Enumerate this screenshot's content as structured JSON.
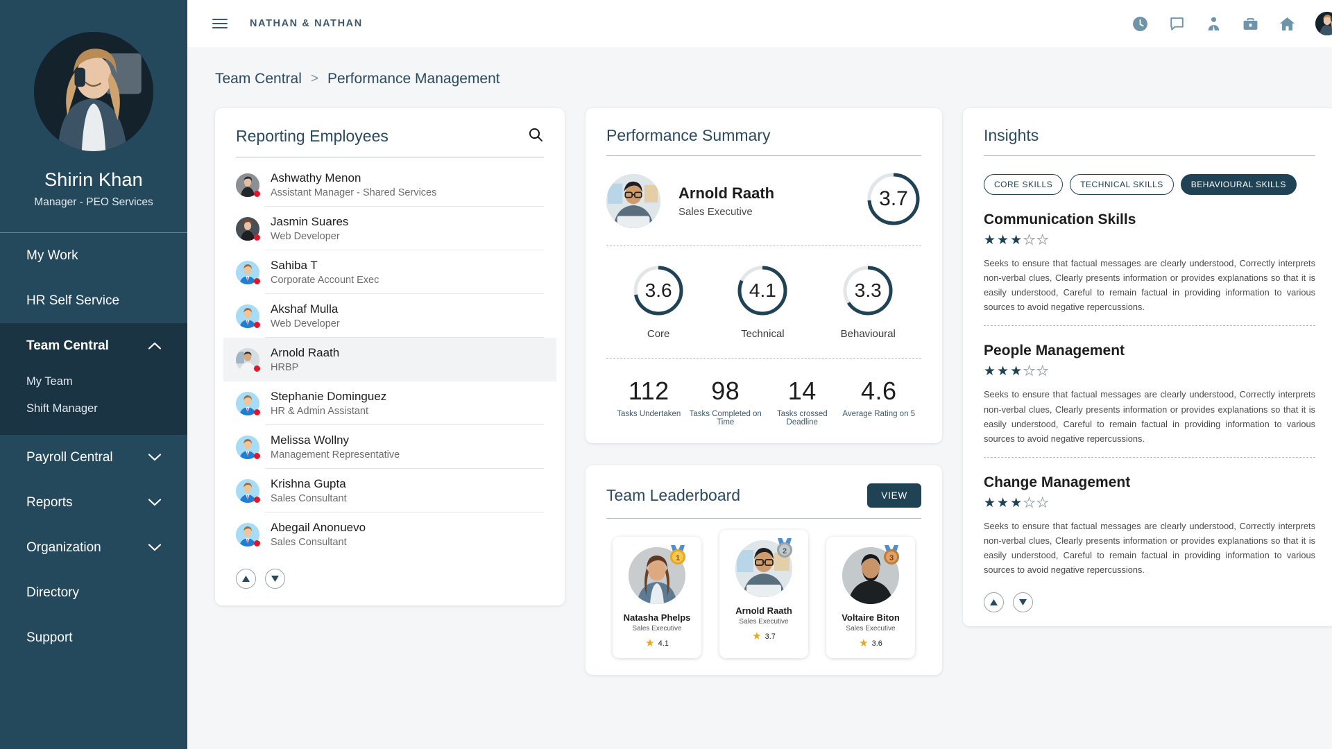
{
  "sidebar": {
    "profile": {
      "name": "Shirin Khan",
      "role": "Manager - PEO Services"
    },
    "items": [
      {
        "label": "My Work",
        "type": "link"
      },
      {
        "label": "HR Self Service",
        "type": "link"
      },
      {
        "label": "Team Central",
        "type": "group",
        "expanded": true,
        "children": [
          {
            "label": "My Team"
          },
          {
            "label": "Shift Manager"
          }
        ]
      },
      {
        "label": "Payroll Central",
        "type": "group",
        "expanded": false
      },
      {
        "label": "Reports",
        "type": "group",
        "expanded": false
      },
      {
        "label": "Organization",
        "type": "group",
        "expanded": false
      },
      {
        "label": "Directory",
        "type": "link"
      },
      {
        "label": "Support",
        "type": "link"
      }
    ]
  },
  "topbar": {
    "brand": "NATHAN & NATHAN",
    "menu_icon": "hamburger-icon",
    "icons": [
      "clock-icon",
      "chat-icon",
      "employee-icon",
      "briefcase-icon",
      "home-icon"
    ],
    "avatar": "user-avatar"
  },
  "breadcrumb": {
    "parent": "Team Central",
    "separator": ">",
    "current": "Performance Management"
  },
  "reporting_employees": {
    "title": "Reporting Employees",
    "search_icon": "search-icon",
    "items": [
      {
        "name": "Ashwathy Menon",
        "role": "Assistant Manager - Shared Services",
        "selected": false,
        "avatar": "photo-f1"
      },
      {
        "name": "Jasmin Suares",
        "role": "Web Developer",
        "selected": false,
        "avatar": "photo-f2"
      },
      {
        "name": "Sahiba T",
        "role": "Corporate Account Exec",
        "selected": false,
        "avatar": "cartoon"
      },
      {
        "name": "Akshaf Mulla",
        "role": "Web Developer",
        "selected": false,
        "avatar": "cartoon"
      },
      {
        "name": "Arnold Raath",
        "role": "HRBP",
        "selected": true,
        "avatar": "photo-m1"
      },
      {
        "name": "Stephanie Dominguez",
        "role": "HR & Admin Assistant",
        "selected": false,
        "avatar": "cartoon"
      },
      {
        "name": "Melissa Wollny",
        "role": "Management Representative",
        "selected": false,
        "avatar": "cartoon"
      },
      {
        "name": "Krishna Gupta",
        "role": "Sales Consultant",
        "selected": false,
        "avatar": "cartoon"
      },
      {
        "name": "Abegail Anonuevo",
        "role": "Sales Consultant",
        "selected": false,
        "avatar": "cartoon"
      }
    ],
    "pager": {
      "up": "scroll-up",
      "down": "scroll-down"
    }
  },
  "performance_summary": {
    "title": "Performance Summary",
    "employee": {
      "name": "Arnold Raath",
      "role": "Sales Executive"
    },
    "overall_score": "3.7",
    "rings": [
      {
        "label": "Core",
        "value": "3.6"
      },
      {
        "label": "Technical",
        "value": "4.1"
      },
      {
        "label": "Behavioural",
        "value": "3.3"
      }
    ],
    "stats": [
      {
        "value": "112",
        "label": "Tasks Undertaken"
      },
      {
        "value": "98",
        "label": "Tasks Completed on Time"
      },
      {
        "value": "14",
        "label": "Tasks crossed Deadline"
      },
      {
        "value": "4.6",
        "label": "Average Rating on 5"
      }
    ]
  },
  "team_leaderboard": {
    "title": "Team Leaderboard",
    "view_label": "VIEW",
    "cards": [
      {
        "name": "Natasha Phelps",
        "role": "Sales Executive",
        "rating": "4.1",
        "rank": "1",
        "avatar": "photo-f3"
      },
      {
        "name": "Arnold Raath",
        "role": "Sales Executive",
        "rating": "3.7",
        "rank": "2",
        "avatar": "photo-m1"
      },
      {
        "name": "Voltaire Biton",
        "role": "Sales Executive",
        "rating": "3.6",
        "rank": "3",
        "avatar": "photo-m2"
      }
    ]
  },
  "insights": {
    "title": "Insights",
    "chips": [
      {
        "label": "CORE SKILLS",
        "active": false
      },
      {
        "label": "TECHNICAL SKILLS",
        "active": false
      },
      {
        "label": "BEHAVIOURAL SKILLS",
        "active": true
      }
    ],
    "skills": [
      {
        "name": "Communication Skills",
        "stars": 3,
        "max_stars": 5,
        "description": "Seeks to ensure that factual messages are clearly understood, Correctly interprets non-verbal clues, Clearly presents information or provides explanations so that it is easily understood, Careful  to remain factual  in  providing  information  to  various  sources  to avoid negative repercussions."
      },
      {
        "name": "People Management",
        "stars": 3,
        "max_stars": 5,
        "description": "Seeks to ensure that factual messages are clearly understood, Correctly interprets non-verbal clues, Clearly presents information or provides explanations so that it is easily understood, Careful  to remain factual  in  providing  information  to  various  sources  to avoid negative repercussions."
      },
      {
        "name": "Change Management",
        "stars": 3,
        "max_stars": 5,
        "description": "Seeks to ensure that factual messages are clearly understood, Correctly interprets non-verbal clues, Clearly presents information or provides explanations so that it is easily understood, Careful  to remain factual  in  providing  information  to  various  sources  to avoid negative repercussions."
      }
    ],
    "pager": {
      "up": "scroll-up",
      "down": "scroll-down"
    }
  },
  "colors": {
    "sidebar_bg": "#24485c",
    "sidebar_active": "#1a3444",
    "accent": "#1f4254",
    "ring_track": "#e3e5e6",
    "status_dot": "#e0162b",
    "star_gold": "#e8a81c",
    "page_bg": "#f5f6f7"
  }
}
